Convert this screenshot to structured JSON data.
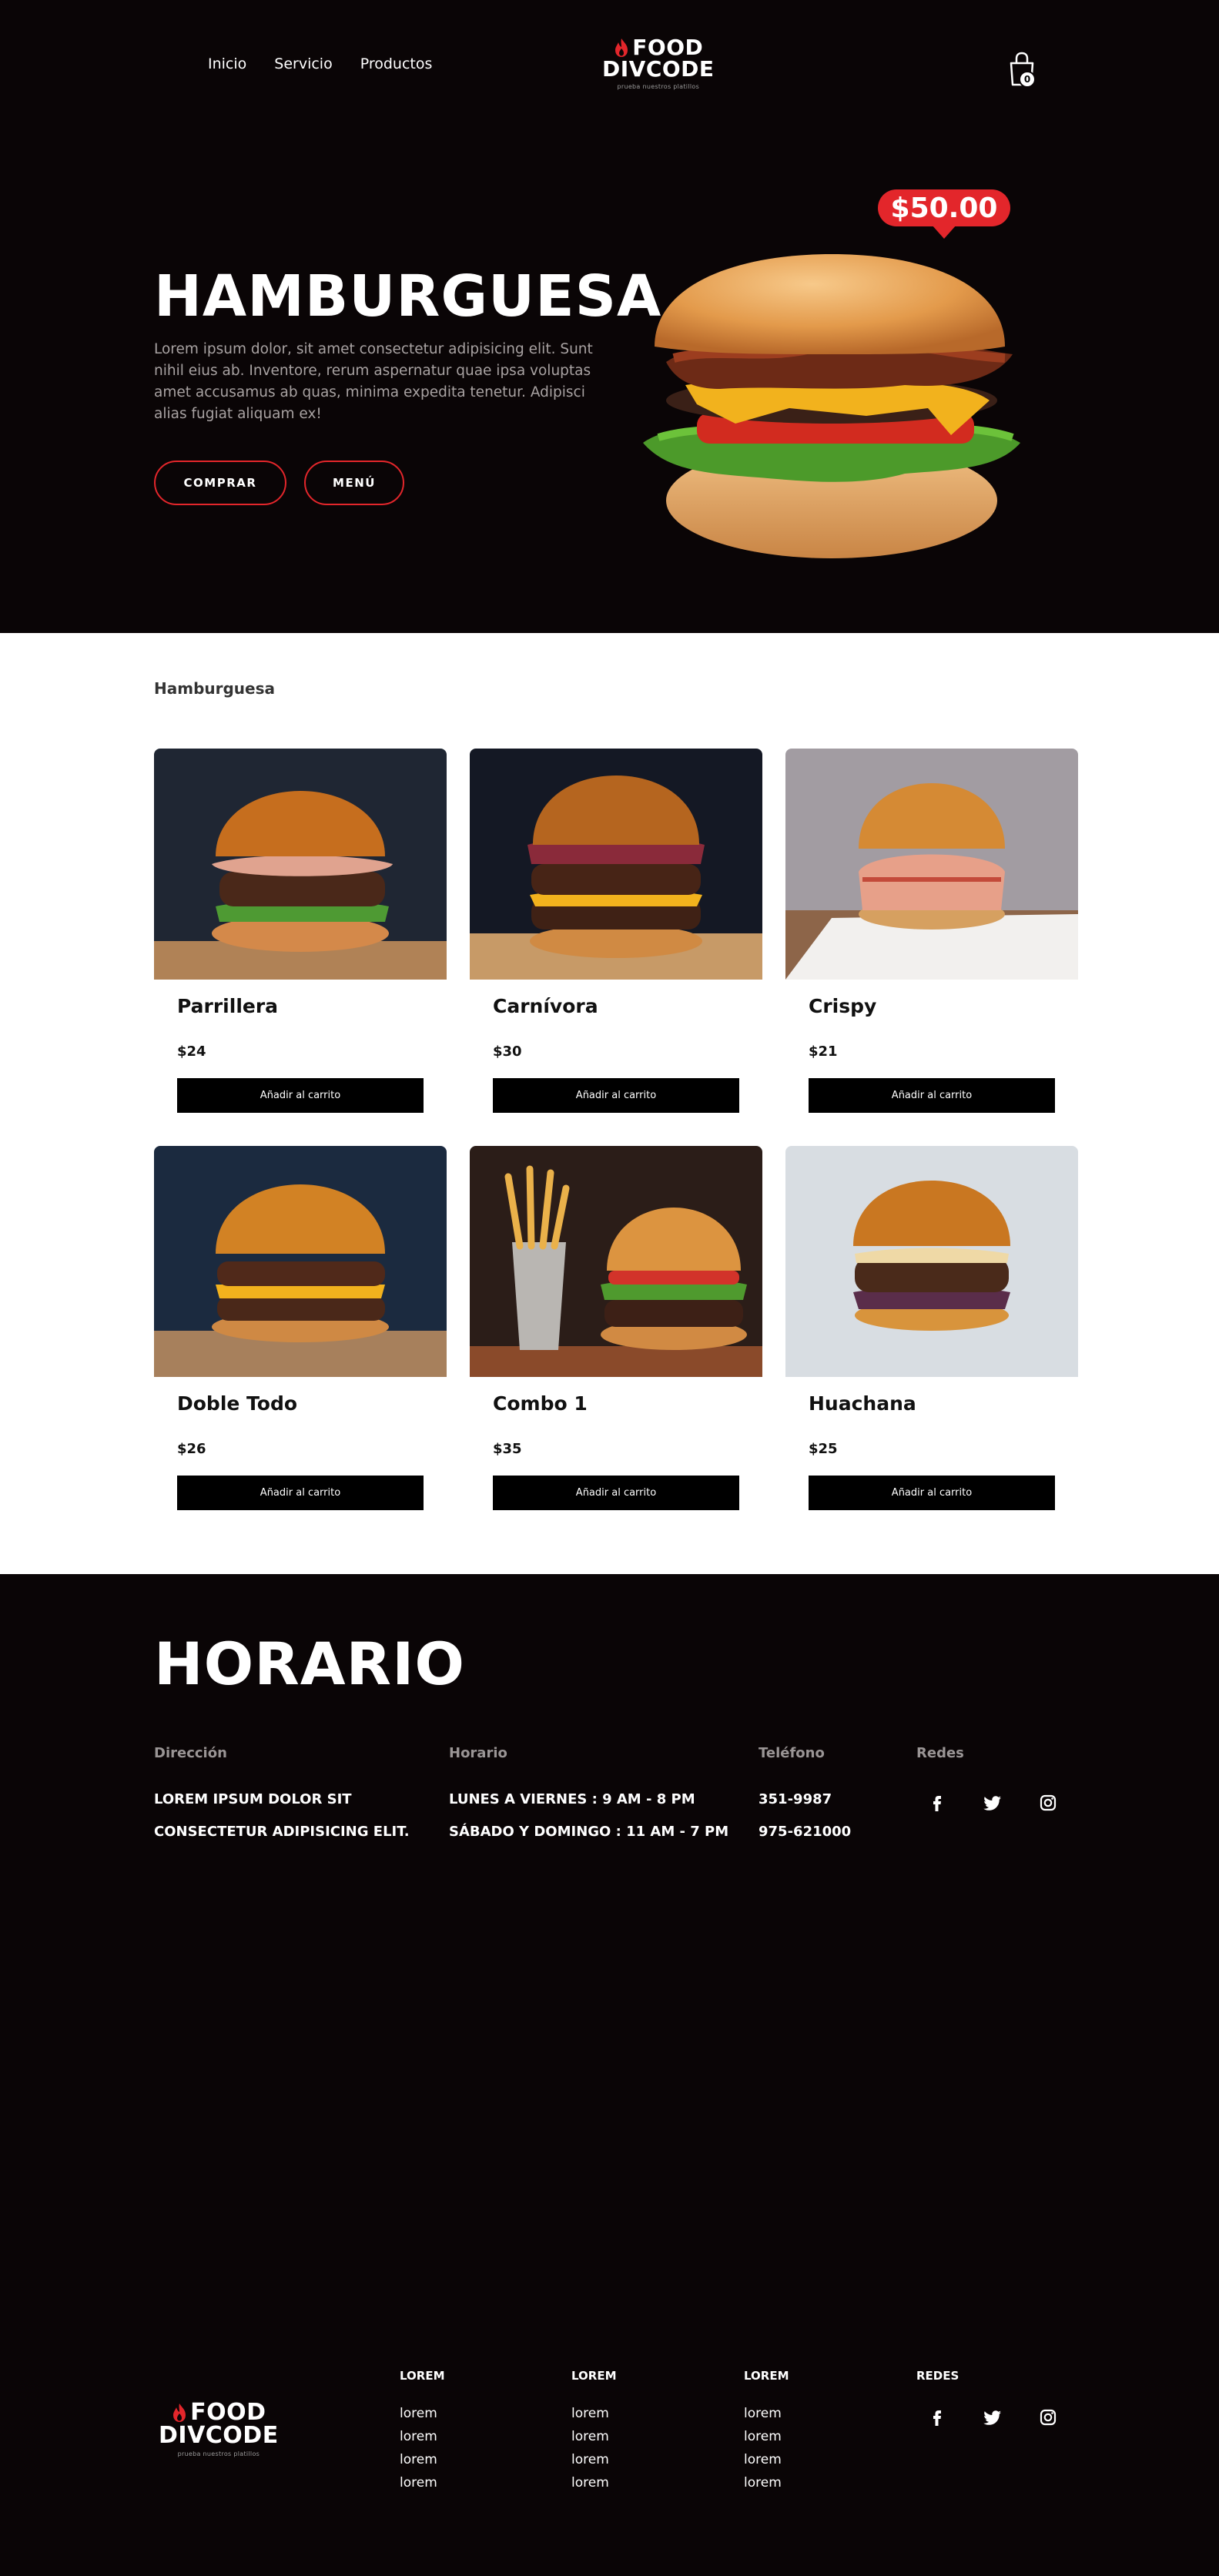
{
  "nav": {
    "links": [
      "Inicio",
      "Servicio",
      "Productos"
    ]
  },
  "brand": {
    "line1": "FOOD",
    "line2": "DIVCODE",
    "tagline": "prueba nuestros platillos"
  },
  "cart": {
    "count": "0"
  },
  "hero": {
    "title": "HAMBURGUESA",
    "text": "Lorem ipsum dolor, sit amet consectetur adipisicing elit. Sunt nihil eius ab. Inventore, rerum aspernatur quae ipsa voluptas amet accusamus ab quas, minima expedita tenetur. Adipisci alias fugiat aliquam ex!",
    "buy_label": "COMPRAR",
    "menu_label": "MENÚ",
    "price": "$50.00"
  },
  "products": {
    "section_label": "Hamburguesa",
    "add_label": "Añadir al carrito",
    "items": [
      {
        "name": "Parrillera",
        "price": "$24"
      },
      {
        "name": "Carnívora",
        "price": "$30"
      },
      {
        "name": "Crispy",
        "price": "$21"
      },
      {
        "name": "Doble Todo",
        "price": "$26"
      },
      {
        "name": "Combo 1",
        "price": "$35"
      },
      {
        "name": "Huachana",
        "price": "$25"
      }
    ]
  },
  "schedule": {
    "title": "HORARIO",
    "address_head": "Dirección",
    "address_lines": [
      "LOREM IPSUM DOLOR SIT",
      "CONSECTETUR ADIPISICING ELIT."
    ],
    "hours_head": "Horario",
    "hours_lines": [
      "LUNES A VIERNES : 9 AM - 8 PM",
      "SÁBADO Y DOMINGO : 11 AM - 7 PM"
    ],
    "phone_head": "Teléfono",
    "phone_lines": [
      "351-9987",
      "975-621000"
    ],
    "social_head": "Redes",
    "social_icons": [
      "facebook-icon",
      "twitter-icon",
      "instagram-icon"
    ]
  },
  "footer": {
    "columns": [
      {
        "head": "LOREM",
        "links": [
          "lorem",
          "lorem",
          "lorem",
          "lorem"
        ]
      },
      {
        "head": "LOREM",
        "links": [
          "lorem",
          "lorem",
          "lorem",
          "lorem"
        ]
      },
      {
        "head": "LOREM",
        "links": [
          "lorem",
          "lorem",
          "lorem",
          "lorem"
        ]
      }
    ],
    "social_head": "REDES"
  },
  "colors": {
    "dark_bg": "#0a0506",
    "accent": "#e3262b",
    "button_bg": "#000000"
  }
}
